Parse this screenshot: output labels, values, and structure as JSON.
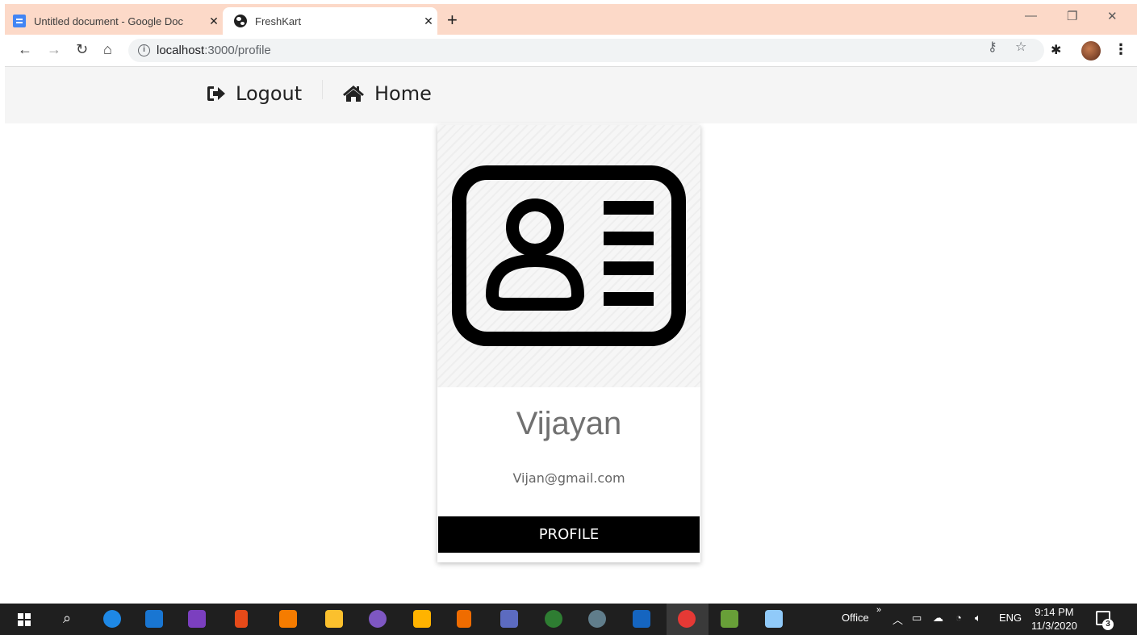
{
  "browser": {
    "tabs": [
      {
        "label": "Untitled document - Google Doc",
        "icon": "google-docs-icon"
      },
      {
        "label": "FreshKart",
        "icon": "globe-icon"
      }
    ],
    "url_host": "localhost",
    "url_path": ":3000/profile"
  },
  "nav": {
    "logout_label": "Logout",
    "home_label": "Home"
  },
  "profile": {
    "name": "Vijayan",
    "email": "Vijan@gmail.com",
    "button_label": "PROFILE"
  },
  "taskbar": {
    "office_label": "Office",
    "language": "ENG",
    "time": "9:14 PM",
    "date": "11/3/2020",
    "notification_count": "3"
  }
}
